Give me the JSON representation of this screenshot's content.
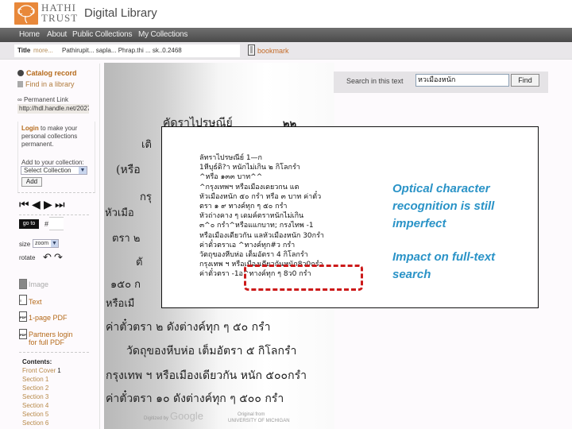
{
  "header": {
    "logo_line1": "HATHI",
    "logo_line2": "TRUST",
    "site_title": "Digital Library",
    "brand_color": "#e8883a"
  },
  "nav": {
    "items": [
      {
        "label": "Home"
      },
      {
        "label": "About"
      },
      {
        "label": "Public Collections"
      },
      {
        "label": "My Collections"
      }
    ]
  },
  "titlebar": {
    "label": "Title",
    "more_link": "more...",
    "title_text": "Pathirupit... sapla... Phrap.thi ... sk..0.2468",
    "bookmark_label": "bookmark"
  },
  "sidebar": {
    "catalog_record": "Catalog record",
    "find_in_library": "Find in a library",
    "permanent_link_label": "Permanent Link",
    "permanent_link_value": "http://hdl.handle.net/2027",
    "login_link": "Login",
    "login_text": " to make your personal collections permanent.",
    "add_to_collection_label": "Add to your collection:",
    "select_collection": "Select Collection",
    "add_button": "Add",
    "pager": {
      "first": "first-page",
      "prev": "previous-page",
      "next": "next-page",
      "last": "last-page"
    },
    "goto_button": "go to",
    "goto_hash": "#",
    "goto_value": "",
    "size_label": "size",
    "size_value": "zoom",
    "rotate_label": "rotate",
    "formats": [
      {
        "label": "Image",
        "icon": "image-icon"
      },
      {
        "label": "Text",
        "icon": "text-icon"
      },
      {
        "label": "1-page PDF",
        "icon": "pdf-icon"
      },
      {
        "label": "Partners login",
        "label2": "for full PDF",
        "icon": "pdf-icon"
      }
    ],
    "contents_title": "Contents:",
    "contents": [
      {
        "label": "Front Cover",
        "page": "1"
      },
      {
        "label": "Section 1",
        "page": ""
      },
      {
        "label": "Section 2",
        "page": ""
      },
      {
        "label": "Section 3",
        "page": ""
      },
      {
        "label": "Section 4",
        "page": ""
      },
      {
        "label": "Section 5",
        "page": ""
      },
      {
        "label": "Section 6",
        "page": ""
      }
    ]
  },
  "scan": {
    "page_heading": "คัดราไปรษณีย์",
    "page_number": "๒๒",
    "lines_left": [
      "เติ",
      "(หรือ",
      "กรุ",
      "หัวเมือ",
      "ตรา ๒",
      "ตั",
      "๑๕๐ ก",
      "หรือเมื"
    ],
    "lines_bottom": [
      "ค่าตั๋วตรา ๒ ดังต่างค์ทุก ๆ ๕๐ กรำ",
      "วัดถุของหีบห่อ  เต็มอัตรา ๕ กิโลกรำ",
      "กรุงเทพ ฯ หรือเมืองเดียวกัน หนัก ๕๐๐กรำ",
      "ค่าตั๋วตรา ๑๐ ดังต่างค์ทุก ๆ ๕๐๐ กรำ"
    ],
    "digitized_by": "Digitized by",
    "google": "Google",
    "original_from": "Original from",
    "university": "UNIVERSITY OF MICHIGAN"
  },
  "search": {
    "label": "Search in this text",
    "value": "หวเมืองหนัก",
    "button": "Find"
  },
  "overlay": {
    "ocr_lines": [
      "ลัทราไปรษณีย์ 1—ก",
      "1หีบุธ์ดิ?า หนักไม่เกิน ๒ กิโลกรำ",
      "^หรือ ๑๓๓ บาท^^",
      "^กรุงเทพฯ หรือเมืองเดยวกน แต",
      "หัวเมืองหนัก ๕๐ กรำ หรือ ๓ บาท ค่าตั๋ว",
      "ตรา ๑ ๙ ทางค์ทุก ๆ ๕๐ กรำ",
      "หัวถ่างคาง ๆ เดมค์ตราหนักไม่เกิน",
      "๓^๐ กรำ^หรือแแกบาท; กรงไทพ -1",
      "หรือเมืองเดียวกัน แลหัวเมืองหนัก 30กรำ",
      "ค่าตั๋วตราเอ ^ทางค์ทุก#ว กรำ",
      "วัตถุของหีบห่อ เต็มอัตรา 4 กิโลกรำ",
      "กรุงเทพ ฯ หรือเมืองเดียวกันหนัก8ว0กรำ",
      "ค่าตั๋วตรา -1อ^ทางค์ทุก ๆ 8ว0 กรำ"
    ],
    "callout1": "Optical character recognition is still imperfect",
    "callout2": "Impact on full-text search",
    "callout_color": "#2a93c7",
    "highlight_color": "#cc1a1a"
  }
}
